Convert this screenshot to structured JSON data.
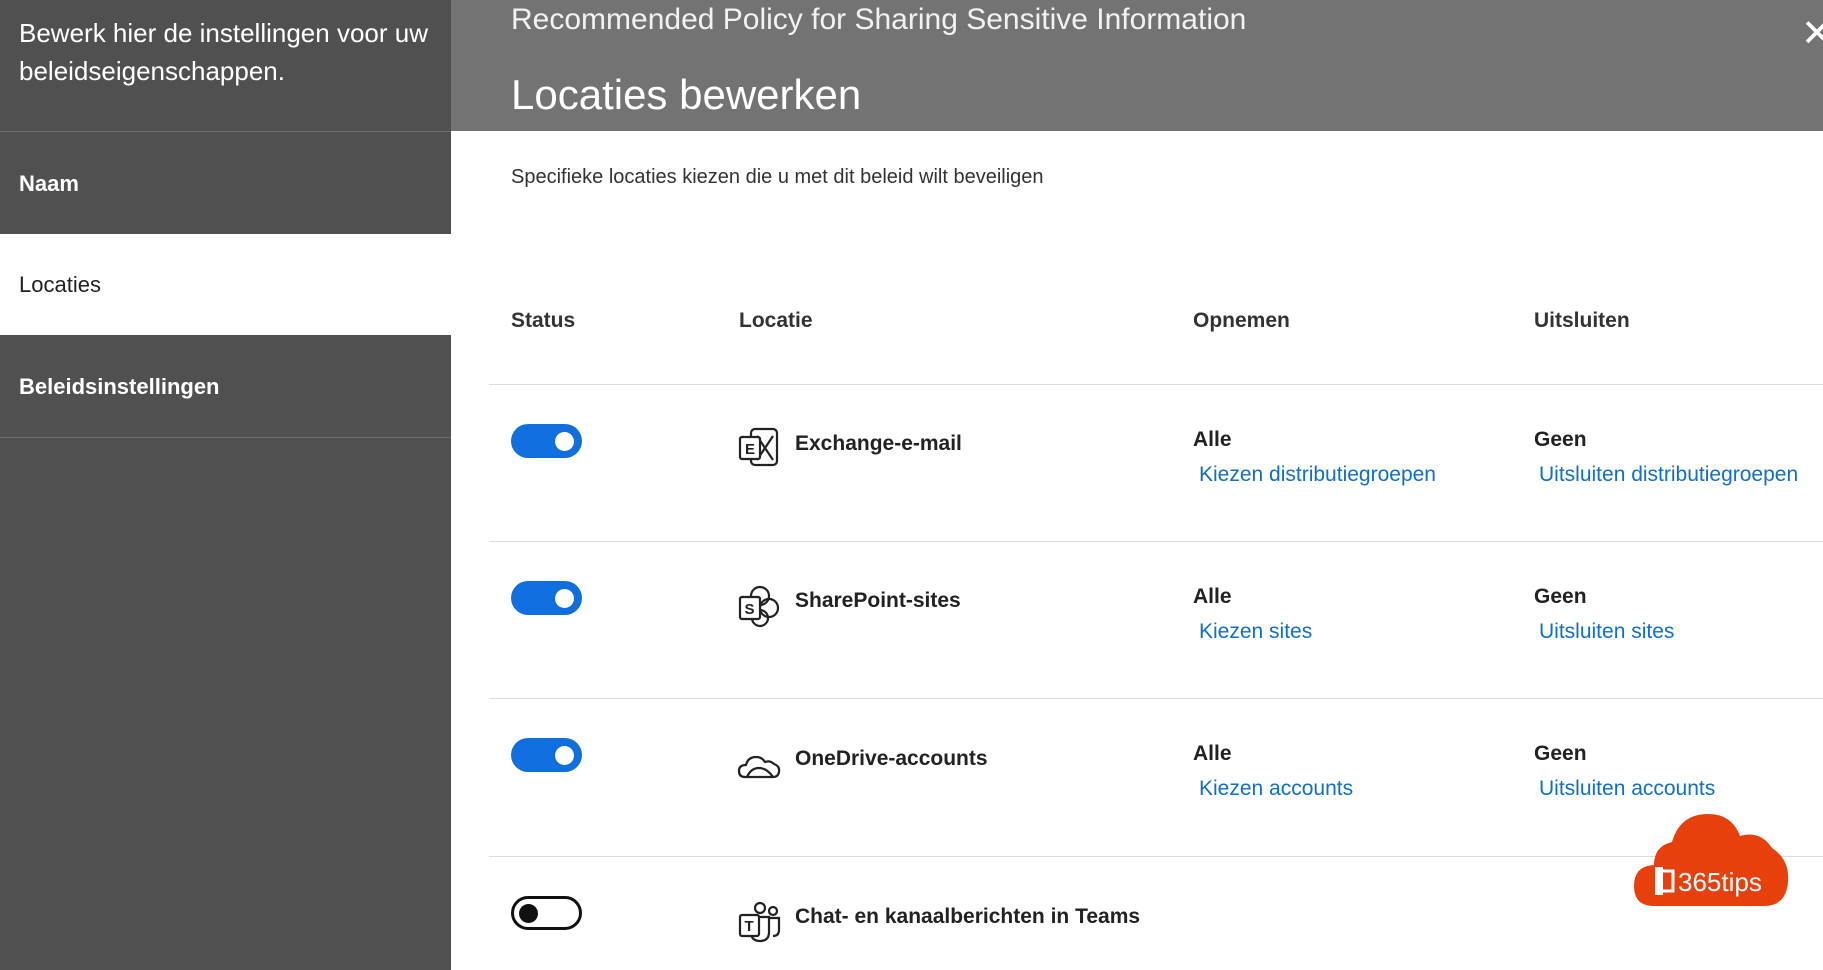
{
  "sidebar": {
    "intro": "Bewerk hier de instellingen voor uw beleidseigenschappen.",
    "items": [
      {
        "label": "Naam",
        "active": false
      },
      {
        "label": "Locaties",
        "active": true
      },
      {
        "label": "Beleidsinstellingen",
        "active": false
      }
    ]
  },
  "header": {
    "policy_title": "Recommended Policy for Sharing Sensitive Information",
    "page_title": "Locaties bewerken",
    "close_icon": "close-icon"
  },
  "main": {
    "description": "Specifieke locaties kiezen die u met dit beleid wilt beveiligen",
    "columns": [
      "Status",
      "Locatie",
      "Opnemen",
      "Uitsluiten"
    ],
    "rows": [
      {
        "enabled": true,
        "icon": "exchange-icon",
        "location": "Exchange-e-mail",
        "include_value": "Alle",
        "include_link": "Kiezen distributiegroepen",
        "exclude_value": "Geen",
        "exclude_link": "Uitsluiten distributiegroepen"
      },
      {
        "enabled": true,
        "icon": "sharepoint-icon",
        "location": "SharePoint-sites",
        "include_value": "Alle",
        "include_link": "Kiezen sites",
        "exclude_value": "Geen",
        "exclude_link": "Uitsluiten sites"
      },
      {
        "enabled": true,
        "icon": "onedrive-icon",
        "location": "OneDrive-accounts",
        "include_value": "Alle",
        "include_link": "Kiezen accounts",
        "exclude_value": "Geen",
        "exclude_link": "Uitsluiten accounts"
      },
      {
        "enabled": false,
        "icon": "teams-icon",
        "location": "Chat- en kanaalberichten in Teams",
        "include_value": "",
        "include_link": "",
        "exclude_value": "",
        "exclude_link": ""
      }
    ]
  },
  "watermark": {
    "text": "365tips",
    "color": "#e8400c"
  },
  "colors": {
    "accent": "#0f6fde",
    "link": "#0f6fce",
    "sidebar": "#505050",
    "header": "#737373"
  }
}
